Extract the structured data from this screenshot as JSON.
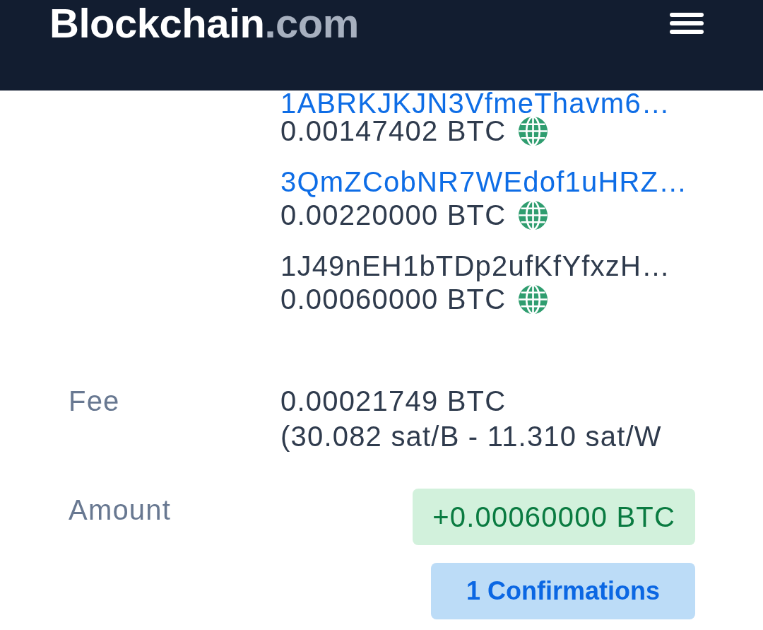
{
  "header": {
    "logo": {
      "name": "Blockchain",
      "suffix": ".com"
    }
  },
  "outputs": [
    {
      "address": "1ABRKJKJN3VfmeThavm6…",
      "linked": true,
      "amount": "0.00147402 BTC"
    },
    {
      "address": "3QmZCobNR7WEdof1uHRZ…",
      "linked": true,
      "amount": "0.00220000 BTC"
    },
    {
      "address": "1J49nEH1bTDp2ufKfYfxzH…",
      "linked": false,
      "amount": "0.00060000 BTC"
    }
  ],
  "fee": {
    "label": "Fee",
    "value": "0.00021749 BTC",
    "rate": "(30.082 sat/B - 11.310 sat/W"
  },
  "amount": {
    "label": "Amount",
    "value": "+0.00060000 BTC",
    "kind": "received"
  },
  "confirmations": "1 Confirmations"
}
